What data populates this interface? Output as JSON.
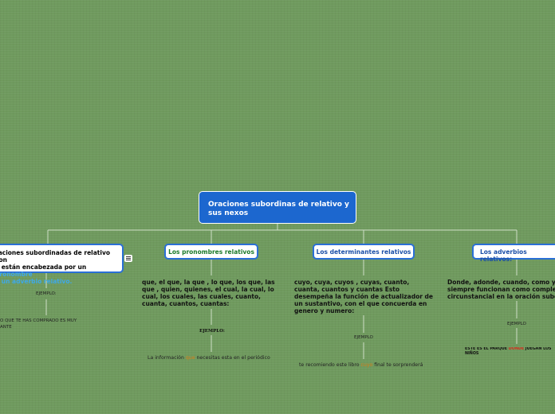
{
  "root": {
    "title": "Oraciones subordinas de relativo y sus nexos"
  },
  "branches": [
    {
      "node_parts": [
        "raciones subordinadas de relativo son",
        "e están encabezada por un ",
        "pronombre",
        "",
        "o ",
        "un adverbio relativo."
      ],
      "example_label": "EJEMPLO:",
      "example_lines": [
        "O QUE TE HAS  COMPRADO ES MUY",
        "ANTE"
      ]
    },
    {
      "title": "Los pronombres relativos",
      "desc": [
        "que, el que, la que , lo que, los que, las",
        "que , quien, quienes, el cual,  la cual, lo",
        "cual, los cuales, las cuales, cuanto,",
        "cuanta, cuantos, cuantas:"
      ],
      "example_label": "EJEMPLO:",
      "example": {
        "before": "La información ",
        "highlight": "que",
        "after": " necesitas esta en el periódico"
      }
    },
    {
      "title": "Los determinantes relativos",
      "desc": [
        "cuyo, cuya, cuyos , cuyas, cuanto,",
        "cuanta, cuantos y cuantas Esto",
        "desempeña la función de actualizador de",
        "un sustantivo, con el que concuerda en",
        "genero y numero:"
      ],
      "example_label": "EJEMPLO",
      "example": {
        "before": "te recomiendo este libro ",
        "highlight": "cuyo",
        "after": " final te sorprenderá"
      }
    },
    {
      "title": "Los adverbios relativos:",
      "desc": [
        "Donde, adonde, cuando, como y",
        "siempre funcionan como complem",
        "circunstancial en la oración subor"
      ],
      "example_label": "EJEMPLO",
      "example": {
        "before": "ESTE ES EL PARQUE ",
        "highlight": "DONDE",
        "after": " JUEGAN LOS",
        "line2": "NIÑOS"
      }
    }
  ],
  "colors": {
    "background": "#6f9a5e",
    "root": "#1c67cf",
    "node_border": "#2a6fd6",
    "green_title": "#1b7a2a",
    "blue_title": "#1b4fa8",
    "highlight_red": "#d52a1d",
    "highlight_orange": "#d87b16"
  }
}
